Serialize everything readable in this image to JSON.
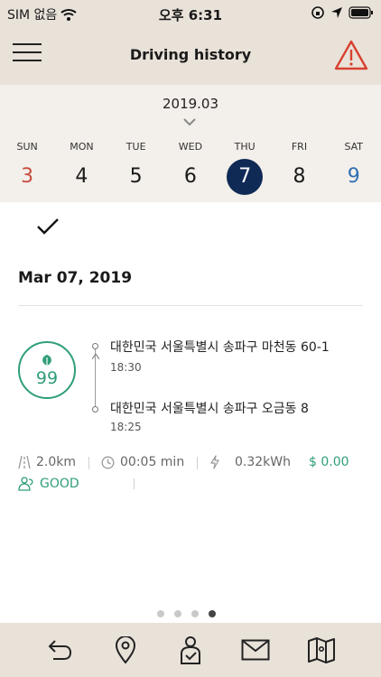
{
  "status_bar": {
    "carrier": "SIM 없음",
    "time": "오후 6:31"
  },
  "nav": {
    "title": "Driving history"
  },
  "calendar": {
    "month": "2019.03",
    "days": [
      {
        "name": "SUN",
        "num": "3"
      },
      {
        "name": "MON",
        "num": "4"
      },
      {
        "name": "TUE",
        "num": "5"
      },
      {
        "name": "WED",
        "num": "6"
      },
      {
        "name": "THU",
        "num": "7"
      },
      {
        "name": "FRI",
        "num": "8"
      },
      {
        "name": "SAT",
        "num": "9"
      }
    ]
  },
  "trip": {
    "date": "Mar 07, 2019",
    "eco_score": "99",
    "destination": "대한민국 서울특별시 송파구 마천동 60-1",
    "destination_time": "18:30",
    "origin": "대한민국 서울특별시 송파구 오금동 8",
    "origin_time": "18:25",
    "distance": "2.0km",
    "duration": "00:05 min",
    "energy": "0.32kWh",
    "cost": "$ 0.00",
    "eco_rating": "GOOD"
  },
  "colors": {
    "header_bg": "#e9e2d9",
    "calendar_bg": "#f3efea",
    "selected_day": "#0f2a55",
    "sunday": "#c94c40",
    "saturday": "#2f6fb3",
    "eco_green": "#2f9e77",
    "alert_red": "#d8402f"
  }
}
